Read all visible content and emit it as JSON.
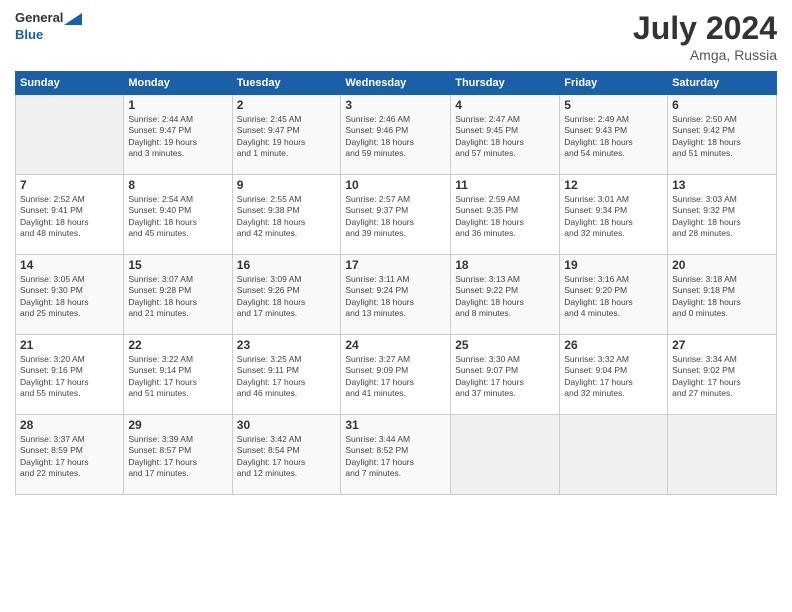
{
  "header": {
    "logo_general": "General",
    "logo_blue": "Blue",
    "month_year": "July 2024",
    "location": "Amga, Russia"
  },
  "days_of_week": [
    "Sunday",
    "Monday",
    "Tuesday",
    "Wednesday",
    "Thursday",
    "Friday",
    "Saturday"
  ],
  "weeks": [
    [
      {
        "day": "",
        "info": ""
      },
      {
        "day": "1",
        "info": "Sunrise: 2:44 AM\nSunset: 9:47 PM\nDaylight: 19 hours\nand 3 minutes."
      },
      {
        "day": "2",
        "info": "Sunrise: 2:45 AM\nSunset: 9:47 PM\nDaylight: 19 hours\nand 1 minute."
      },
      {
        "day": "3",
        "info": "Sunrise: 2:46 AM\nSunset: 9:46 PM\nDaylight: 18 hours\nand 59 minutes."
      },
      {
        "day": "4",
        "info": "Sunrise: 2:47 AM\nSunset: 9:45 PM\nDaylight: 18 hours\nand 57 minutes."
      },
      {
        "day": "5",
        "info": "Sunrise: 2:49 AM\nSunset: 9:43 PM\nDaylight: 18 hours\nand 54 minutes."
      },
      {
        "day": "6",
        "info": "Sunrise: 2:50 AM\nSunset: 9:42 PM\nDaylight: 18 hours\nand 51 minutes."
      }
    ],
    [
      {
        "day": "7",
        "info": "Sunrise: 2:52 AM\nSunset: 9:41 PM\nDaylight: 18 hours\nand 48 minutes."
      },
      {
        "day": "8",
        "info": "Sunrise: 2:54 AM\nSunset: 9:40 PM\nDaylight: 18 hours\nand 45 minutes."
      },
      {
        "day": "9",
        "info": "Sunrise: 2:55 AM\nSunset: 9:38 PM\nDaylight: 18 hours\nand 42 minutes."
      },
      {
        "day": "10",
        "info": "Sunrise: 2:57 AM\nSunset: 9:37 PM\nDaylight: 18 hours\nand 39 minutes."
      },
      {
        "day": "11",
        "info": "Sunrise: 2:59 AM\nSunset: 9:35 PM\nDaylight: 18 hours\nand 36 minutes."
      },
      {
        "day": "12",
        "info": "Sunrise: 3:01 AM\nSunset: 9:34 PM\nDaylight: 18 hours\nand 32 minutes."
      },
      {
        "day": "13",
        "info": "Sunrise: 3:03 AM\nSunset: 9:32 PM\nDaylight: 18 hours\nand 28 minutes."
      }
    ],
    [
      {
        "day": "14",
        "info": "Sunrise: 3:05 AM\nSunset: 9:30 PM\nDaylight: 18 hours\nand 25 minutes."
      },
      {
        "day": "15",
        "info": "Sunrise: 3:07 AM\nSunset: 9:28 PM\nDaylight: 18 hours\nand 21 minutes."
      },
      {
        "day": "16",
        "info": "Sunrise: 3:09 AM\nSunset: 9:26 PM\nDaylight: 18 hours\nand 17 minutes."
      },
      {
        "day": "17",
        "info": "Sunrise: 3:11 AM\nSunset: 9:24 PM\nDaylight: 18 hours\nand 13 minutes."
      },
      {
        "day": "18",
        "info": "Sunrise: 3:13 AM\nSunset: 9:22 PM\nDaylight: 18 hours\nand 8 minutes."
      },
      {
        "day": "19",
        "info": "Sunrise: 3:16 AM\nSunset: 9:20 PM\nDaylight: 18 hours\nand 4 minutes."
      },
      {
        "day": "20",
        "info": "Sunrise: 3:18 AM\nSunset: 9:18 PM\nDaylight: 18 hours\nand 0 minutes."
      }
    ],
    [
      {
        "day": "21",
        "info": "Sunrise: 3:20 AM\nSunset: 9:16 PM\nDaylight: 17 hours\nand 55 minutes."
      },
      {
        "day": "22",
        "info": "Sunrise: 3:22 AM\nSunset: 9:14 PM\nDaylight: 17 hours\nand 51 minutes."
      },
      {
        "day": "23",
        "info": "Sunrise: 3:25 AM\nSunset: 9:11 PM\nDaylight: 17 hours\nand 46 minutes."
      },
      {
        "day": "24",
        "info": "Sunrise: 3:27 AM\nSunset: 9:09 PM\nDaylight: 17 hours\nand 41 minutes."
      },
      {
        "day": "25",
        "info": "Sunrise: 3:30 AM\nSunset: 9:07 PM\nDaylight: 17 hours\nand 37 minutes."
      },
      {
        "day": "26",
        "info": "Sunrise: 3:32 AM\nSunset: 9:04 PM\nDaylight: 17 hours\nand 32 minutes."
      },
      {
        "day": "27",
        "info": "Sunrise: 3:34 AM\nSunset: 9:02 PM\nDaylight: 17 hours\nand 27 minutes."
      }
    ],
    [
      {
        "day": "28",
        "info": "Sunrise: 3:37 AM\nSunset: 8:59 PM\nDaylight: 17 hours\nand 22 minutes."
      },
      {
        "day": "29",
        "info": "Sunrise: 3:39 AM\nSunset: 8:57 PM\nDaylight: 17 hours\nand 17 minutes."
      },
      {
        "day": "30",
        "info": "Sunrise: 3:42 AM\nSunset: 8:54 PM\nDaylight: 17 hours\nand 12 minutes."
      },
      {
        "day": "31",
        "info": "Sunrise: 3:44 AM\nSunset: 8:52 PM\nDaylight: 17 hours\nand 7 minutes."
      },
      {
        "day": "",
        "info": ""
      },
      {
        "day": "",
        "info": ""
      },
      {
        "day": "",
        "info": ""
      }
    ]
  ]
}
